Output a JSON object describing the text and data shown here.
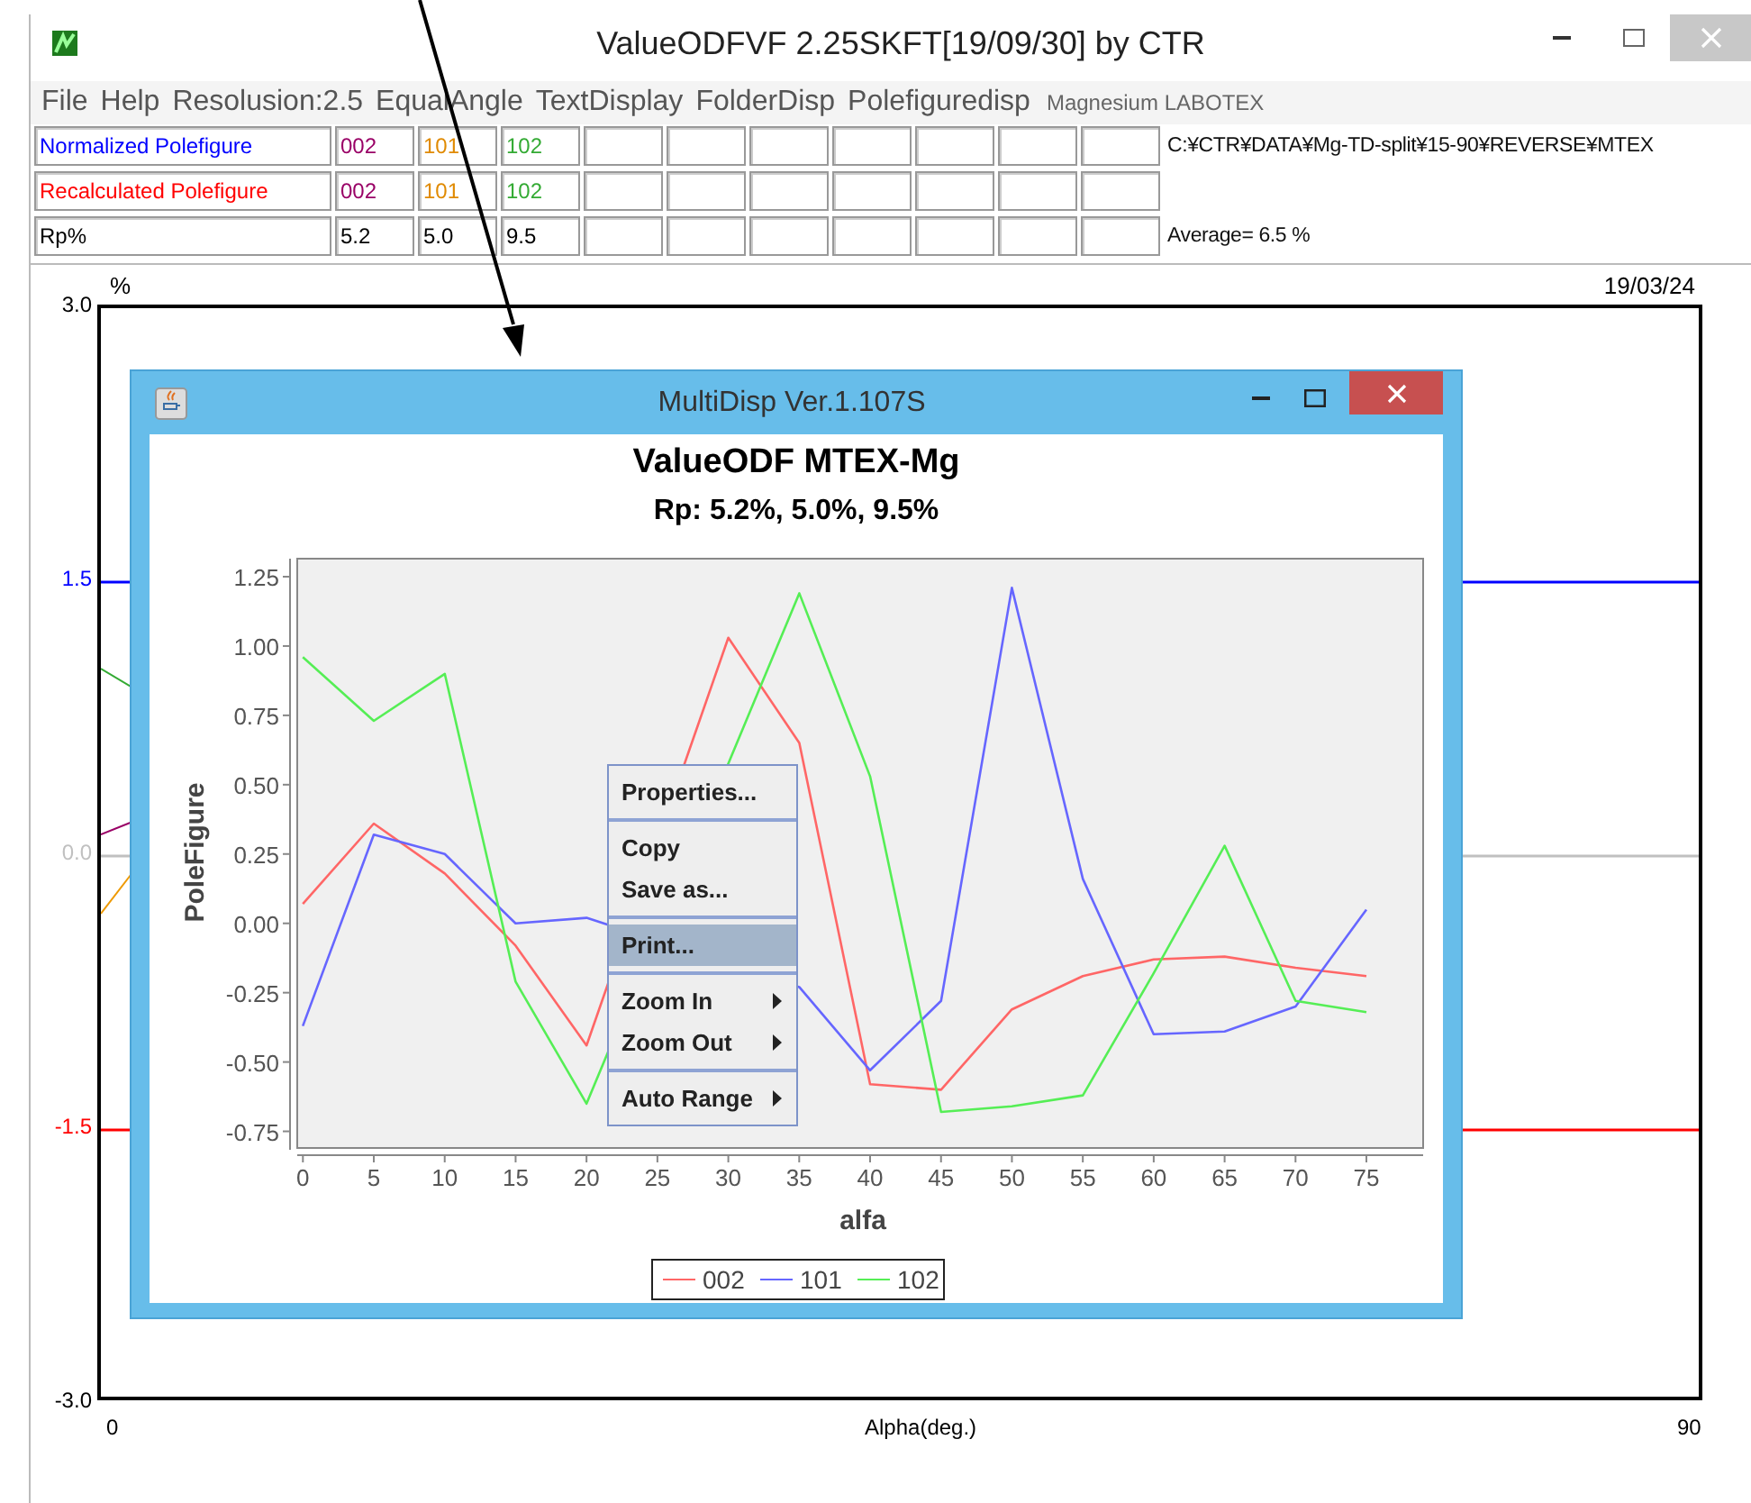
{
  "main_window": {
    "title": "ValueODFVF 2.25SKFT[19/09/30] by CTR"
  },
  "menu": [
    {
      "label": "File",
      "kind": "menu"
    },
    {
      "label": "Help",
      "kind": "menu"
    },
    {
      "label": "Resolusion:2.5",
      "kind": "menu"
    },
    {
      "label": "EqualAngle",
      "kind": "menu"
    },
    {
      "label": "TextDisplay",
      "kind": "menu"
    },
    {
      "label": "FolderDisp",
      "kind": "menu"
    },
    {
      "label": "Polefiguredisp",
      "kind": "menu"
    },
    {
      "label": "Magnesium LABOTEX",
      "kind": "note"
    }
  ],
  "table": {
    "rows": [
      {
        "label": "Normalized Polefigure",
        "color": "#0000ff",
        "cells": [
          {
            "text": "002",
            "color": "#990066"
          },
          {
            "text": "101",
            "color": "#e08a00"
          },
          {
            "text": "102",
            "color": "#33aa33"
          }
        ],
        "note": "C:¥CTR¥DATA¥Mg-TD-split¥15-90¥REVERSE¥MTEX"
      },
      {
        "label": "Recalculated Polefigure",
        "color": "#ff0000",
        "cells": [
          {
            "text": "002",
            "color": "#990066"
          },
          {
            "text": "101",
            "color": "#e08a00"
          },
          {
            "text": "102",
            "color": "#33aa33"
          }
        ]
      },
      {
        "label": "Rp%",
        "color": "#000000",
        "cells": [
          {
            "text": "5.2",
            "color": "#000000"
          },
          {
            "text": "5.0",
            "color": "#000000"
          },
          {
            "text": "9.5",
            "color": "#000000"
          }
        ],
        "note": "Average= 6.5 %"
      }
    ]
  },
  "plot": {
    "unit": "%",
    "date": "19/03/24",
    "xlabel": "Alpha(deg.)",
    "x_start": "0",
    "x_end": "90",
    "y_labels": [
      {
        "text": "3.0",
        "color": "#000000"
      },
      {
        "text": "1.5",
        "color": "#0000ff",
        "guide": true
      },
      {
        "text": "0.0",
        "color": "#c0c0c0",
        "guide": true
      },
      {
        "text": "-1.5",
        "color": "#ff0000",
        "guide": true
      },
      {
        "text": "-3.0",
        "color": "#000000"
      }
    ]
  },
  "dialog": {
    "title": "MultiDisp Ver.1.107S",
    "subtitle": "Rp:  5.2%, 5.0%, 9.5%",
    "chart_data": {
      "type": "line",
      "title": "ValueODF MTEX-Mg",
      "xlabel": "alfa",
      "ylabel": "PoleFigure",
      "x": [
        0,
        5,
        10,
        15,
        20,
        25,
        30,
        35,
        40,
        45,
        50,
        55,
        60,
        65,
        70,
        75
      ],
      "series": [
        {
          "name": "002",
          "color": "#ff6666",
          "values": [
            0.07,
            0.36,
            0.18,
            -0.08,
            -0.44,
            null,
            1.03,
            0.65,
            -0.58,
            -0.6,
            -0.31,
            -0.19,
            -0.13,
            -0.12,
            -0.16,
            -0.19
          ]
        },
        {
          "name": "101",
          "color": "#6666ff",
          "values": [
            -0.37,
            0.32,
            0.25,
            0.0,
            0.02,
            null,
            null,
            -0.23,
            -0.53,
            -0.28,
            1.21,
            0.16,
            -0.4,
            -0.39,
            -0.3,
            0.05
          ]
        },
        {
          "name": "102",
          "color": "#55ee55",
          "values": [
            0.96,
            0.73,
            0.9,
            -0.21,
            -0.65,
            null,
            null,
            1.19,
            0.53,
            -0.68,
            -0.66,
            -0.62,
            -0.18,
            0.28,
            -0.28,
            -0.32
          ]
        }
      ],
      "xlim": [
        -0.4,
        79
      ],
      "ylim": [
        -0.81,
        1.315
      ],
      "legend": "bottom",
      "xticks": [
        0,
        5,
        10,
        15,
        20,
        25,
        30,
        35,
        40,
        45,
        50,
        55,
        60,
        65,
        70,
        75
      ],
      "yticks": [
        {
          "value": -0.75,
          "label": "-0.75"
        },
        {
          "value": -0.5,
          "label": "-0.50"
        },
        {
          "value": -0.25,
          "label": "-0.25"
        },
        {
          "value": 0,
          "label": "0.00"
        },
        {
          "value": 0.25,
          "label": "0.25"
        },
        {
          "value": 0.5,
          "label": "0.50"
        },
        {
          "value": 0.75,
          "label": "0.75"
        },
        {
          "value": 1,
          "label": "1.00"
        },
        {
          "value": 1.25,
          "label": "1.25"
        }
      ]
    }
  },
  "context_menu": {
    "groups": [
      [
        {
          "label": "Properties...",
          "selected": false,
          "submenu": false
        }
      ],
      [
        {
          "label": "Copy",
          "selected": false,
          "submenu": false
        },
        {
          "label": "Save as...",
          "selected": false,
          "submenu": false
        }
      ],
      [
        {
          "label": "Print...",
          "selected": true,
          "submenu": false
        }
      ],
      [
        {
          "label": "Zoom In",
          "selected": false,
          "submenu": true
        },
        {
          "label": "Zoom Out",
          "selected": false,
          "submenu": true
        }
      ],
      [
        {
          "label": "Auto Range",
          "selected": false,
          "submenu": true
        }
      ]
    ]
  }
}
